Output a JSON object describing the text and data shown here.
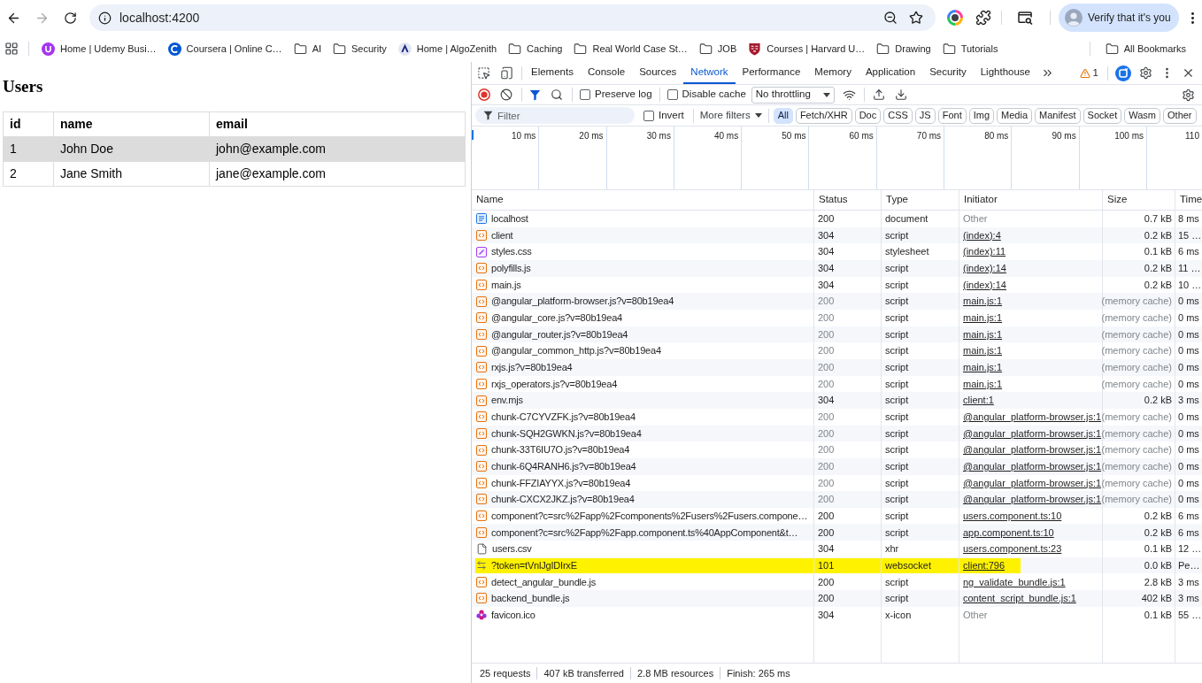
{
  "browser": {
    "url": "localhost:4200",
    "forward_disabled": true,
    "profile_button": "Verify that it's you"
  },
  "bookmarks": {
    "items": [
      {
        "label": "Home | Udemy Busi…",
        "kind": "u-logo"
      },
      {
        "label": "Coursera | Online C…",
        "kind": "c-logo"
      },
      {
        "label": "AI",
        "kind": "folder"
      },
      {
        "label": "Security",
        "kind": "folder"
      },
      {
        "label": "Home | AlgoZenith",
        "kind": "a-logo"
      },
      {
        "label": "Caching",
        "kind": "folder"
      },
      {
        "label": "Real World Case St…",
        "kind": "folder"
      },
      {
        "label": "JOB",
        "kind": "folder"
      },
      {
        "label": "Courses | Harvard U…",
        "kind": "shield-logo"
      },
      {
        "label": "Drawing",
        "kind": "folder"
      },
      {
        "label": "Tutorials",
        "kind": "folder"
      }
    ],
    "all_bookmarks": "All Bookmarks"
  },
  "page": {
    "title": "Users",
    "columns": [
      "id",
      "name",
      "email"
    ],
    "rows": [
      {
        "cells": [
          "1",
          "John Doe",
          "john@example.com"
        ],
        "highlighted": true
      },
      {
        "cells": [
          "2",
          "Jane Smith",
          "jane@example.com"
        ],
        "highlighted": false
      }
    ]
  },
  "devtools": {
    "tabs": [
      {
        "label": "Elements",
        "selected": false
      },
      {
        "label": "Console",
        "selected": false
      },
      {
        "label": "Sources",
        "selected": false
      },
      {
        "label": "Network",
        "selected": true
      },
      {
        "label": "Performance",
        "selected": false
      },
      {
        "label": "Memory",
        "selected": false
      },
      {
        "label": "Application",
        "selected": false
      },
      {
        "label": "Security",
        "selected": false
      },
      {
        "label": "Lighthouse",
        "selected": false
      }
    ],
    "issues_count": "1",
    "preserve_log": {
      "label": "Preserve log",
      "checked": false
    },
    "disable_cache": {
      "label": "Disable cache",
      "checked": false
    },
    "throttling": "No throttling",
    "filter": {
      "placeholder": "Filter",
      "invert": {
        "label": "Invert",
        "checked": false
      },
      "more_filters": "More filters",
      "types": [
        {
          "label": "All",
          "selected": true
        },
        {
          "label": "Fetch/XHR",
          "selected": false
        },
        {
          "label": "Doc",
          "selected": false
        },
        {
          "label": "CSS",
          "selected": false
        },
        {
          "label": "JS",
          "selected": false
        },
        {
          "label": "Font",
          "selected": false
        },
        {
          "label": "Img",
          "selected": false
        },
        {
          "label": "Media",
          "selected": false
        },
        {
          "label": "Manifest",
          "selected": false
        },
        {
          "label": "Socket",
          "selected": false
        },
        {
          "label": "Wasm",
          "selected": false
        },
        {
          "label": "Other",
          "selected": false
        }
      ]
    },
    "timeline_ticks": [
      "10 ms",
      "20 ms",
      "30 ms",
      "40 ms",
      "50 ms",
      "60 ms",
      "70 ms",
      "80 ms",
      "90 ms",
      "100 ms",
      "110"
    ],
    "columns": [
      "Name",
      "Status",
      "Type",
      "Initiator",
      "Size",
      "Time"
    ],
    "requests": [
      {
        "name": "localhost",
        "kind": "document",
        "status": "200",
        "type": "document",
        "initiator": "Other",
        "initiator_is_link": false,
        "size": "0.7 kB",
        "time": "8 ms",
        "cached": false,
        "highlighted": false
      },
      {
        "name": "client",
        "kind": "script",
        "status": "304",
        "type": "script",
        "initiator": "(index):4",
        "initiator_is_link": true,
        "size": "0.2 kB",
        "time": "15 …",
        "cached": false,
        "highlighted": false
      },
      {
        "name": "styles.css",
        "kind": "stylesheet",
        "status": "304",
        "type": "stylesheet",
        "initiator": "(index):11",
        "initiator_is_link": true,
        "size": "0.1 kB",
        "time": "6 ms",
        "cached": false,
        "highlighted": false
      },
      {
        "name": "polyfills.js",
        "kind": "script",
        "status": "304",
        "type": "script",
        "initiator": "(index):14",
        "initiator_is_link": true,
        "size": "0.2 kB",
        "time": "11 …",
        "cached": false,
        "highlighted": false
      },
      {
        "name": "main.js",
        "kind": "script",
        "status": "304",
        "type": "script",
        "initiator": "(index):14",
        "initiator_is_link": true,
        "size": "0.2 kB",
        "time": "10 …",
        "cached": false,
        "highlighted": false
      },
      {
        "name": "@angular_platform-browser.js?v=80b19ea4",
        "kind": "script",
        "status": "200",
        "type": "script",
        "initiator": "main.js:1",
        "initiator_is_link": true,
        "size": "(memory cache)",
        "time": "0 ms",
        "cached": true,
        "highlighted": false
      },
      {
        "name": "@angular_core.js?v=80b19ea4",
        "kind": "script",
        "status": "200",
        "type": "script",
        "initiator": "main.js:1",
        "initiator_is_link": true,
        "size": "(memory cache)",
        "time": "0 ms",
        "cached": true,
        "highlighted": false
      },
      {
        "name": "@angular_router.js?v=80b19ea4",
        "kind": "script",
        "status": "200",
        "type": "script",
        "initiator": "main.js:1",
        "initiator_is_link": true,
        "size": "(memory cache)",
        "time": "0 ms",
        "cached": true,
        "highlighted": false
      },
      {
        "name": "@angular_common_http.js?v=80b19ea4",
        "kind": "script",
        "status": "200",
        "type": "script",
        "initiator": "main.js:1",
        "initiator_is_link": true,
        "size": "(memory cache)",
        "time": "0 ms",
        "cached": true,
        "highlighted": false
      },
      {
        "name": "rxjs.js?v=80b19ea4",
        "kind": "script",
        "status": "200",
        "type": "script",
        "initiator": "main.js:1",
        "initiator_is_link": true,
        "size": "(memory cache)",
        "time": "0 ms",
        "cached": true,
        "highlighted": false
      },
      {
        "name": "rxjs_operators.js?v=80b19ea4",
        "kind": "script",
        "status": "200",
        "type": "script",
        "initiator": "main.js:1",
        "initiator_is_link": true,
        "size": "(memory cache)",
        "time": "0 ms",
        "cached": true,
        "highlighted": false
      },
      {
        "name": "env.mjs",
        "kind": "script",
        "status": "304",
        "type": "script",
        "initiator": "client:1",
        "initiator_is_link": true,
        "size": "0.2 kB",
        "time": "3 ms",
        "cached": false,
        "highlighted": false
      },
      {
        "name": "chunk-C7CYVZFK.js?v=80b19ea4",
        "kind": "script",
        "status": "200",
        "type": "script",
        "initiator": "@angular_platform-browser.js:1",
        "initiator_is_link": true,
        "size": "(memory cache)",
        "time": "0 ms",
        "cached": true,
        "highlighted": false
      },
      {
        "name": "chunk-SQH2GWKN.js?v=80b19ea4",
        "kind": "script",
        "status": "200",
        "type": "script",
        "initiator": "@angular_platform-browser.js:1",
        "initiator_is_link": true,
        "size": "(memory cache)",
        "time": "0 ms",
        "cached": true,
        "highlighted": false
      },
      {
        "name": "chunk-33T6IU7O.js?v=80b19ea4",
        "kind": "script",
        "status": "200",
        "type": "script",
        "initiator": "@angular_platform-browser.js:1",
        "initiator_is_link": true,
        "size": "(memory cache)",
        "time": "0 ms",
        "cached": true,
        "highlighted": false
      },
      {
        "name": "chunk-6Q4RANH6.js?v=80b19ea4",
        "kind": "script",
        "status": "200",
        "type": "script",
        "initiator": "@angular_platform-browser.js:1",
        "initiator_is_link": true,
        "size": "(memory cache)",
        "time": "0 ms",
        "cached": true,
        "highlighted": false
      },
      {
        "name": "chunk-FFZIAYYX.js?v=80b19ea4",
        "kind": "script",
        "status": "200",
        "type": "script",
        "initiator": "@angular_platform-browser.js:1",
        "initiator_is_link": true,
        "size": "(memory cache)",
        "time": "0 ms",
        "cached": true,
        "highlighted": false
      },
      {
        "name": "chunk-CXCX2JKZ.js?v=80b19ea4",
        "kind": "script",
        "status": "200",
        "type": "script",
        "initiator": "@angular_platform-browser.js:1",
        "initiator_is_link": true,
        "size": "(memory cache)",
        "time": "0 ms",
        "cached": true,
        "highlighted": false
      },
      {
        "name": "component?c=src%2Fapp%2Fcomponents%2Fusers%2Fusers.compone…",
        "kind": "script",
        "status": "200",
        "type": "script",
        "initiator": "users.component.ts:10",
        "initiator_is_link": true,
        "size": "0.2 kB",
        "time": "6 ms",
        "cached": false,
        "highlighted": false
      },
      {
        "name": "component?c=src%2Fapp%2Fapp.component.ts%40AppComponent&t…",
        "kind": "script",
        "status": "200",
        "type": "script",
        "initiator": "app.component.ts:10",
        "initiator_is_link": true,
        "size": "0.2 kB",
        "time": "6 ms",
        "cached": false,
        "highlighted": false
      },
      {
        "name": "users.csv",
        "kind": "fetch",
        "status": "304",
        "type": "xhr",
        "initiator": "users.component.ts:23",
        "initiator_is_link": true,
        "size": "0.1 kB",
        "time": "12 …",
        "cached": false,
        "highlighted": false
      },
      {
        "name": "?token=tVnlJgIDIrxE",
        "kind": "websocket",
        "status": "101",
        "type": "websocket",
        "initiator": "client:796",
        "initiator_is_link": true,
        "size": "0.0 kB",
        "time": "Pe…",
        "cached": false,
        "highlighted": true
      },
      {
        "name": "detect_angular_bundle.js",
        "kind": "script",
        "status": "200",
        "type": "script",
        "initiator": "ng_validate_bundle.js:1",
        "initiator_is_link": true,
        "size": "2.8 kB",
        "time": "3 ms",
        "cached": false,
        "highlighted": false
      },
      {
        "name": "backend_bundle.js",
        "kind": "script",
        "status": "200",
        "type": "script",
        "initiator": "content_script_bundle.js:1",
        "initiator_is_link": true,
        "size": "402 kB",
        "time": "3 ms",
        "cached": false,
        "highlighted": false
      },
      {
        "name": "favicon.ico",
        "kind": "image",
        "status": "304",
        "type": "x-icon",
        "initiator": "Other",
        "initiator_is_link": false,
        "size": "0.1 kB",
        "time": "55 …",
        "cached": false,
        "highlighted": false
      }
    ],
    "summary": [
      "25 requests",
      "407 kB transferred",
      "2.8 MB resources",
      "Finish: 265 ms"
    ]
  }
}
